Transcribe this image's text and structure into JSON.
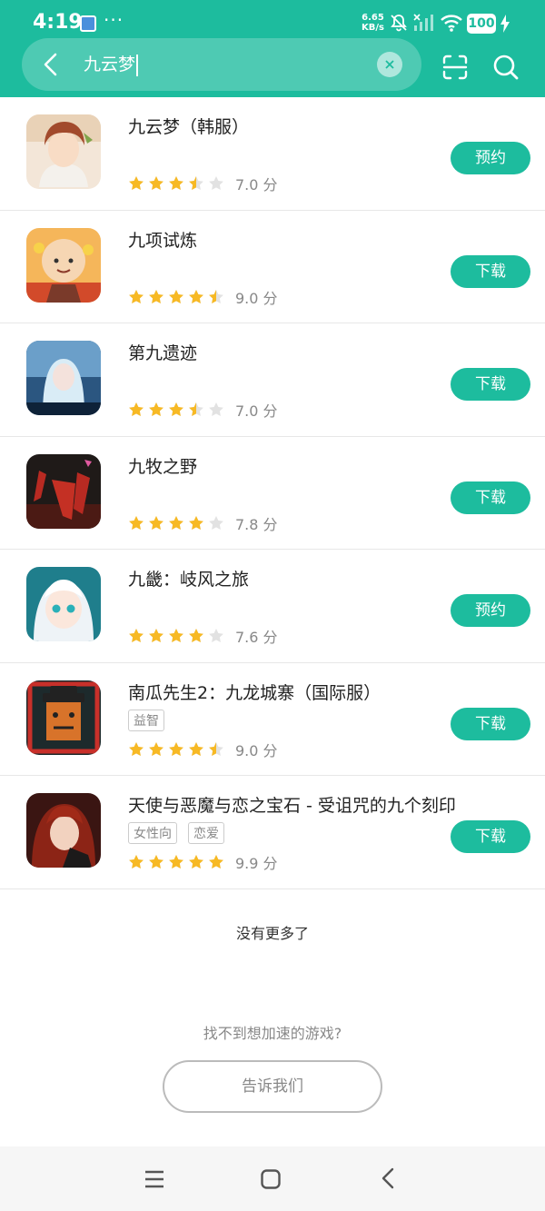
{
  "status_bar": {
    "time": "4:19",
    "net_speed_value": "6.65",
    "net_speed_unit": "KB/s",
    "battery": "100",
    "more_dots": "···"
  },
  "search": {
    "query": "九云梦"
  },
  "results": [
    {
      "title": "九云梦（韩服）",
      "tags": [],
      "stars": 3.5,
      "score": "7.0 分",
      "button": "预约"
    },
    {
      "title": "九项试炼",
      "tags": [],
      "stars": 4.5,
      "score": "9.0 分",
      "button": "下载"
    },
    {
      "title": "第九遗迹",
      "tags": [],
      "stars": 3.5,
      "score": "7.0 分",
      "button": "下载"
    },
    {
      "title": "九牧之野",
      "tags": [],
      "stars": 4,
      "score": "7.8 分",
      "button": "下载"
    },
    {
      "title": "九畿：岐风之旅",
      "tags": [],
      "stars": 4,
      "score": "7.6 分",
      "button": "预约"
    },
    {
      "title": "南瓜先生2：九龙城寨（国际服）",
      "tags": [
        "益智"
      ],
      "stars": 4.5,
      "score": "9.0 分",
      "button": "下载"
    },
    {
      "title": "天使与恶魔与恋之宝石 - 受诅咒的九个刻印",
      "tags": [
        "女性向",
        "恋爱"
      ],
      "stars": 5,
      "score": "9.9 分",
      "button": "下载"
    }
  ],
  "footer": {
    "no_more": "没有更多了",
    "prompt": "找不到想加速的游戏?",
    "tell_button": "告诉我们"
  },
  "colors": {
    "accent": "#1dbc9e",
    "star": "#f7b924",
    "star_empty": "#e2e2e2"
  }
}
